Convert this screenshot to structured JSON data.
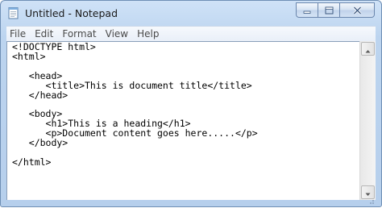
{
  "window": {
    "title": "Untitled - Notepad",
    "icon": "notepad-icon",
    "controls": [
      "minimize-icon",
      "maximize-icon",
      "close-icon"
    ]
  },
  "menu": {
    "items": [
      {
        "label": "File"
      },
      {
        "label": "Edit"
      },
      {
        "label": "Format"
      },
      {
        "label": "View"
      },
      {
        "label": "Help"
      }
    ]
  },
  "editor": {
    "content": "<!DOCTYPE html>\n<html>\n\n   <head>\n      <title>This is document title</title>\n   </head>\n\n   <body>\n      <h1>This is a heading</h1>\n      <p>Document content goes here.....</p>\n   </body>\n\n</html>"
  },
  "colors": {
    "frame": "#bcd4ef",
    "menu_text": "#4a4a4a",
    "editor_bg": "#ffffff"
  }
}
